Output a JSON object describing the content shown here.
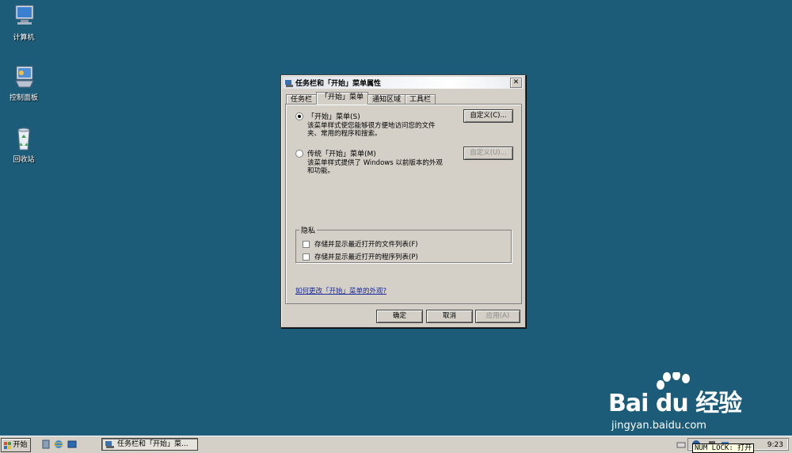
{
  "desktop": {
    "icons": [
      {
        "label": "计算机"
      },
      {
        "label": "控制面板"
      },
      {
        "label": "回收站"
      }
    ]
  },
  "dialog": {
    "title": "任务栏和「开始」菜单属性",
    "close_label": "✕",
    "tabs": [
      {
        "label": "任务栏",
        "active": false
      },
      {
        "label": "「开始」菜单",
        "active": true
      },
      {
        "label": "通知区域",
        "active": false
      },
      {
        "label": "工具栏",
        "active": false
      }
    ],
    "options": [
      {
        "label": "「开始」菜单(S)",
        "selected": true,
        "description": "该菜单样式使您能够很方便地访问您的文件夹、常用的程序和搜索。",
        "customize": "自定义(C)...",
        "customize_enabled": true
      },
      {
        "label": "传统「开始」菜单(M)",
        "selected": false,
        "description": "该菜单样式提供了 Windows 以前版本的外观和功能。",
        "customize": "自定义(U)...",
        "customize_enabled": false
      }
    ],
    "privacy": {
      "title": "隐私",
      "items": [
        {
          "label": "存储并显示最近打开的文件列表(F)",
          "checked": false
        },
        {
          "label": "存储并显示最近打开的程序列表(P)",
          "checked": false
        }
      ]
    },
    "help_link": "如何更改「开始」菜单的外观?",
    "buttons": {
      "ok": "确定",
      "cancel": "取消",
      "apply": "应用(A)"
    }
  },
  "taskbar": {
    "start_label": "开始",
    "task_label": "任务栏和「开始」菜...",
    "clock": "9:23",
    "numlock_tip": "NUM LOCK: 打开"
  },
  "watermark": {
    "brand": "Bai du 经验",
    "url": "jingyan.baidu.com"
  }
}
